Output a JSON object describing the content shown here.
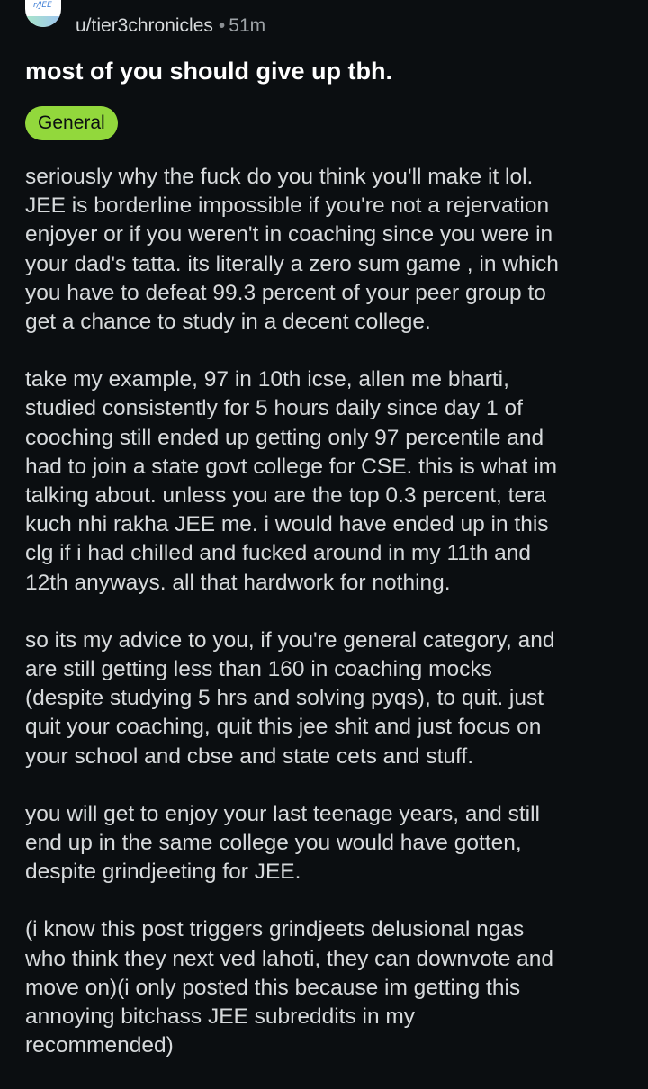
{
  "post": {
    "subreddit_icon_text": "r/JEE",
    "author": "u/tier3chronicles",
    "separator": "•",
    "time": "51m",
    "title": "most of you should give up tbh.",
    "flair": "General",
    "paragraphs": [
      "seriously why the fuck do you think you'll make it lol.\nJEE is borderline impossible if you're not a rejervation\nenjoyer or if you weren't in coaching since you were in\nyour dad's tatta. its literally a zero sum game , in which\nyou have to defeat 99.3 percent of your peer group to\nget a chance to study in a decent college.",
      "take my example, 97 in 10th icse, allen me bharti,\nstudied consistently for 5 hours daily since day 1 of\ncooching still ended up getting only 97 percentile and\nhad to join a state govt college for CSE. this is what im\ntalking about. unless you are the top 0.3 percent, tera\nkuch nhi rakha JEE me. i would have ended up in this\nclg if i had chilled and fucked around in my 11th and\n12th anyways. all that hardwork for nothing.",
      "so its my advice to you, if you're general category, and\nare still getting less than 160 in coaching mocks\n(despite studying 5 hrs and solving pyqs), to quit. just\nquit your coaching, quit this jee shit and just focus on\nyour school and cbse and state cets and stuff.",
      "you will get to enjoy your last teenage years, and still\nend up in the same college you would have gotten,\ndespite grindjeeting for JEE.",
      "(i know this post triggers grindjeets delusional ngas\nwho think they next ved lahoti, they can downvote and\nmove on)(i only posted this because im getting this\nannoying bitchass JEE subreddits in my\nrecommended)"
    ]
  },
  "colors": {
    "background": "#0b0e11",
    "text": "#d7dadc",
    "flair_bg": "#92d83c"
  }
}
